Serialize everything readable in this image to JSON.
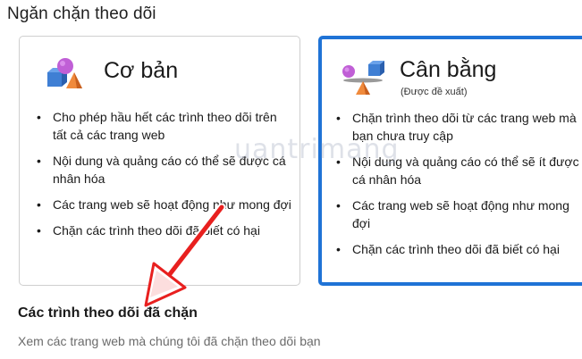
{
  "section": {
    "title": "Ngăn chặn theo dõi"
  },
  "cards": {
    "basic": {
      "title": "Cơ bản",
      "icon": "shapes-icon",
      "bullets": [
        "Cho phép hầu hết các trình theo dõi trên tất cả các trang web",
        "Nội dung và quảng cáo có thể sẽ được cá nhân hóa",
        "Các trang web sẽ hoạt động như mong đợi",
        "Chặn các trình theo dõi đã biết có hại"
      ]
    },
    "balanced": {
      "title": "Cân bằng",
      "subtitle": "(Được đề xuất)",
      "icon": "balanced-shapes-icon",
      "selected": true,
      "bullets": [
        "Chặn trình theo dõi từ các trang web mà bạn chưa truy cập",
        "Nội dung và quảng cáo có thể sẽ ít được cá nhân hóa",
        "Các trang web sẽ hoạt động như mong đợi",
        "Chặn các trình theo dõi đã biết có hại"
      ]
    }
  },
  "blocked": {
    "title": "Các trình theo dõi đã chặn",
    "description": "Xem các trang web mà chúng tôi đã chặn theo dõi bạn"
  },
  "watermark": {
    "text": "uantrimang"
  },
  "colors": {
    "accent": "#1f73d6",
    "arrow": "#e8201f",
    "card_border": "#cfcfcf",
    "muted_text": "#6b6b6b"
  }
}
